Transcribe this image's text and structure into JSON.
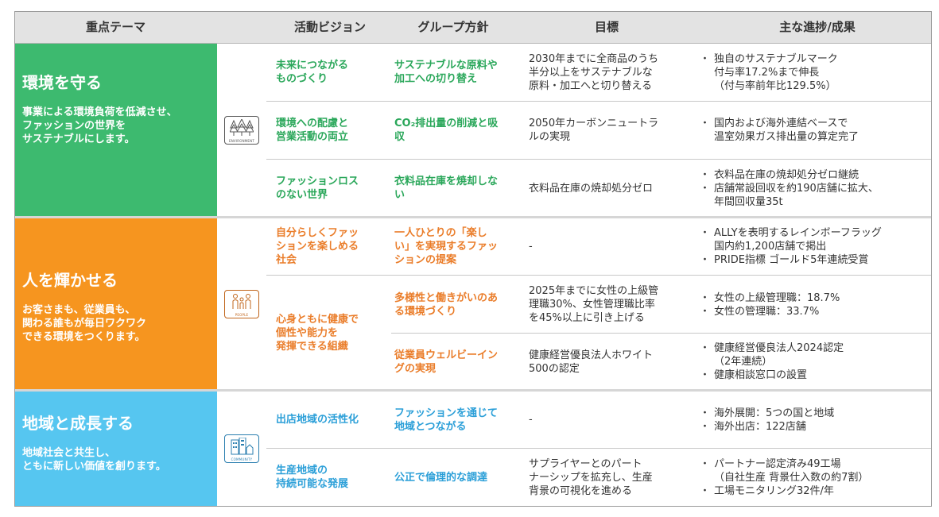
{
  "header": {
    "col_theme": "重点テーマ",
    "col_vision": "活動ビジョン",
    "col_policy": "グループ方針",
    "col_goal": "目標",
    "col_progress": "主な進捗/成果"
  },
  "colors": {
    "green": "#3dba6f",
    "orange": "#f6951f",
    "blue": "#56c6f0"
  },
  "themes": [
    {
      "title": "環境を守る",
      "desc": [
        "事業による環境負荷を低減させ、",
        "ファッションの世界を",
        "サステナブルにします。"
      ],
      "icon": "tree-icon",
      "icon_tag": "ENVIRONMENT",
      "rows": [
        {
          "vision": [
            "未来につながる",
            "ものづくり"
          ],
          "policy": [
            "サステナブルな原料や",
            "加工への切り替え"
          ],
          "goal": [
            "2030年までに全商品のうち",
            "半分以上をサステナブルな",
            "原料・加工へと切り替える"
          ],
          "progress": [
            [
              "独自のサステナブルマーク",
              "付与率17.2%まで伸長",
              "（付与率前年比129.5%）"
            ]
          ]
        },
        {
          "vision": [
            "環境への配慮と",
            "営業活動の両立"
          ],
          "policy": [
            "CO₂排出量の削減と吸",
            "収"
          ],
          "goal": [
            "2050年カーボンニュートラ",
            "ルの実現"
          ],
          "progress": [
            [
              "国内および海外連結ベースで",
              "温室効果ガス排出量の算定完了"
            ]
          ]
        },
        {
          "vision": [
            "ファッションロス",
            "のない世界"
          ],
          "policy": [
            "衣料品在庫を焼却しな",
            "い"
          ],
          "goal": [
            "衣料品在庫の焼却処分ゼロ"
          ],
          "progress": [
            [
              "衣料品在庫の焼却処分ゼロ継続"
            ],
            [
              "店舗常設回収を約190店舗に拡大、",
              "年間回収量35t"
            ]
          ]
        }
      ]
    },
    {
      "title": "人を輝かせる",
      "desc": [
        "お客さまも、従業員も、",
        "関わる誰もが毎日ワクワク",
        "できる環境をつくります。"
      ],
      "icon": "people-icon",
      "icon_tag": "PEOPLE",
      "vision_merged": [
        "心身ともに健康で",
        "個性や能力を",
        "発揮できる組織"
      ],
      "rows": [
        {
          "vision": [
            "自分らしくファッ",
            "ションを楽しめる",
            "社会"
          ],
          "policy": [
            "一人ひとりの「楽し",
            "い」を実現するファッ",
            "ションの提案"
          ],
          "goal": [
            "-"
          ],
          "progress": [
            [
              "ALLYを表明するレインボーフラッグ",
              "国内約1,200店舗で掲出"
            ],
            [
              "PRIDE指標 ゴールド5年連続受賞"
            ]
          ]
        },
        {
          "vision": [],
          "policy": [
            "多様性と働きがいのあ",
            "る環境づくり"
          ],
          "goal": [
            "2025年までに女性の上級管",
            "理職30%、女性管理職比率",
            "を45%以上に引き上げる"
          ],
          "progress": [
            [
              "女性の上級管理職：18.7%"
            ],
            [
              "女性の管理職：33.7%"
            ]
          ]
        },
        {
          "vision": [],
          "policy": [
            "従業員ウェルビーイン",
            "グの実現"
          ],
          "goal": [
            "健康経営優良法人ホワイト",
            "500の認定"
          ],
          "progress": [
            [
              "健康経営優良法人2024認定",
              "（2年連続）"
            ],
            [
              "健康相談窓口の設置"
            ]
          ]
        }
      ]
    },
    {
      "title": "地域と成長する",
      "desc": [
        "地域社会と共生し、",
        "ともに新しい価値を創ります。"
      ],
      "icon": "community-icon",
      "icon_tag": "COMMUNITY",
      "rows": [
        {
          "vision": [
            "出店地域の活性化"
          ],
          "policy": [
            "ファッションを通じて",
            "地域とつながる"
          ],
          "goal": [
            "-"
          ],
          "progress": [
            [
              "海外展開：5つの国と地域"
            ],
            [
              "海外出店：122店舗"
            ]
          ]
        },
        {
          "vision": [
            "生産地域の",
            "持続可能な発展"
          ],
          "policy": [
            "公正で倫理的な調達"
          ],
          "goal": [
            "サプライヤーとのパート",
            "ナーシップを拡充し、生産",
            "背景の可視化を進める"
          ],
          "progress": [
            [
              "パートナー認定済み49工場",
              "（自社生産 背景仕入数の約7割）"
            ],
            [
              "工場モニタリング32件/年"
            ]
          ]
        }
      ]
    }
  ]
}
